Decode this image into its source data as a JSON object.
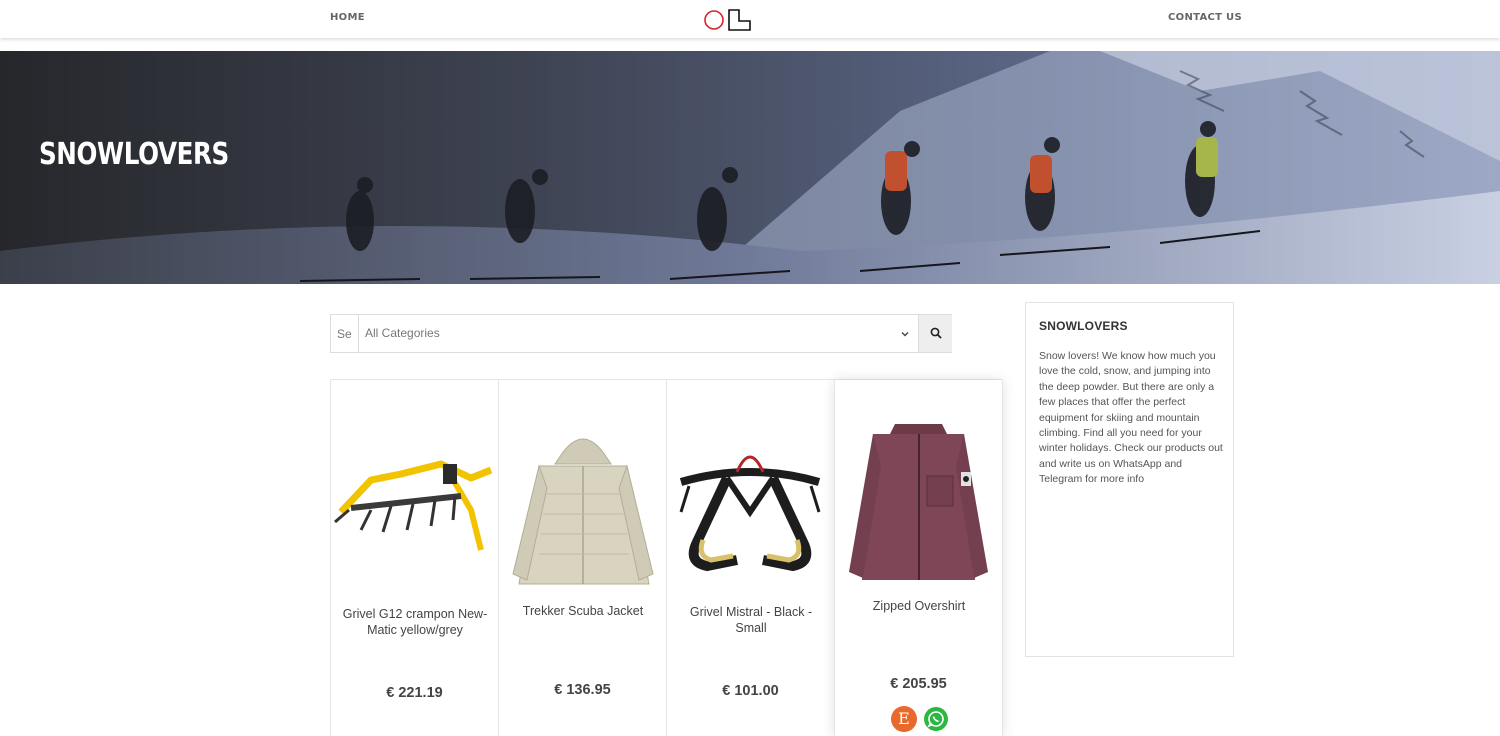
{
  "header": {
    "home_label": "HOME",
    "contact_label": "CONTACT US",
    "logo_icon": "ol-logo-icon"
  },
  "hero": {
    "title": "SNOWLOVERS"
  },
  "search": {
    "input_value": "Se",
    "category_selected": "All Categories",
    "button_icon": "search-icon"
  },
  "products": [
    {
      "name": "Grivel G12 crampon New-Matic yellow/grey",
      "price": "€ 221.19",
      "image_icon": "crampon-icon"
    },
    {
      "name": "Trekker Scuba Jacket",
      "price": "€ 136.95",
      "image_icon": "jacket-icon"
    },
    {
      "name": "Grivel Mistral - Black - Small",
      "price": "€ 101.00",
      "image_icon": "harness-icon"
    },
    {
      "name": "Zipped Overshirt",
      "price": "€ 205.95",
      "image_icon": "overshirt-icon"
    }
  ],
  "product_actions": {
    "etsy_label": "E",
    "etsy_icon": "etsy-icon",
    "whatsapp_icon": "whatsapp-icon"
  },
  "sidebar": {
    "title": "SNOWLOVERS",
    "text": "Snow lovers! We know how much you love the cold, snow, and jumping into the deep powder. But there are only a few places that offer the perfect equipment for skiing and mountain climbing. Find all you need for your winter holidays. Check our products out and write us on WhatsApp and Telegram for more info"
  },
  "colors": {
    "accent_red": "#d8232a",
    "etsy_orange": "#e8692c",
    "whatsapp_green": "#2bb741",
    "hero_dark": "#2c2f36"
  }
}
